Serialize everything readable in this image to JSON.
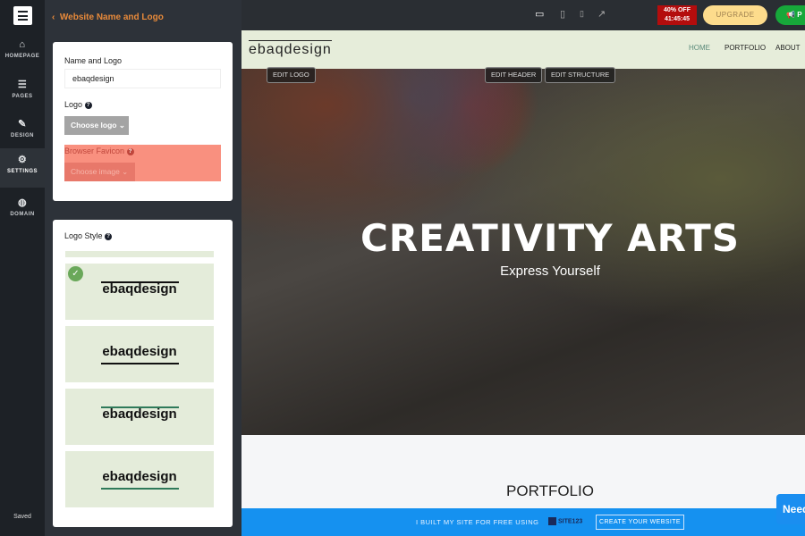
{
  "sidebar": {
    "items": [
      {
        "label": "HOMEPAGE",
        "icon": "home-icon"
      },
      {
        "label": "PAGES",
        "icon": "pages-icon"
      },
      {
        "label": "DESIGN",
        "icon": "brush-icon"
      },
      {
        "label": "SETTINGS",
        "icon": "gear-icon",
        "active": true
      },
      {
        "label": "DOMAIN",
        "icon": "globe-icon"
      }
    ],
    "status": "Saved"
  },
  "panel": {
    "back_label": "Website Name and Logo",
    "name_label": "Name and Logo",
    "name_value": "ebaqdesign",
    "logo_label": "Logo",
    "choose_logo": "Choose logo",
    "favicon_label": "Browser Favicon",
    "choose_image": "Choose image",
    "style_label": "Logo Style",
    "style_options": [
      "ebaqdesign",
      "ebaqdesign",
      "ebaqdesign",
      "ebaqdesign"
    ],
    "selected_style": 0
  },
  "topbar": {
    "deal_line1": "40% OFF",
    "deal_line2": "41:45:45",
    "upgrade": "UPGRADE",
    "publish": "P"
  },
  "site": {
    "logo": "ebaqdesign",
    "nav": [
      "HOME",
      "PORTFOLIO",
      "ABOUT"
    ],
    "edit_logo": "EDIT LOGO",
    "edit_header": "EDIT HEADER",
    "edit_structure": "EDIT STRUCTURE",
    "hero_title": "CREATIVITY ARTS",
    "hero_subtitle": "Express Yourself",
    "section_title": "PORTFOLIO"
  },
  "banner": {
    "text": "I BUILT MY SITE FOR FREE USING",
    "brand": "SITE123",
    "cta": "CREATE YOUR WEBSITE"
  },
  "chat": {
    "label": "Need"
  },
  "colors": {
    "accent": "#e88a3a",
    "highlight": "#f9907f",
    "banner": "#1591f0",
    "upgrade": "#fddc8c",
    "publish": "#17a83a",
    "deal": "#b40d0d"
  }
}
